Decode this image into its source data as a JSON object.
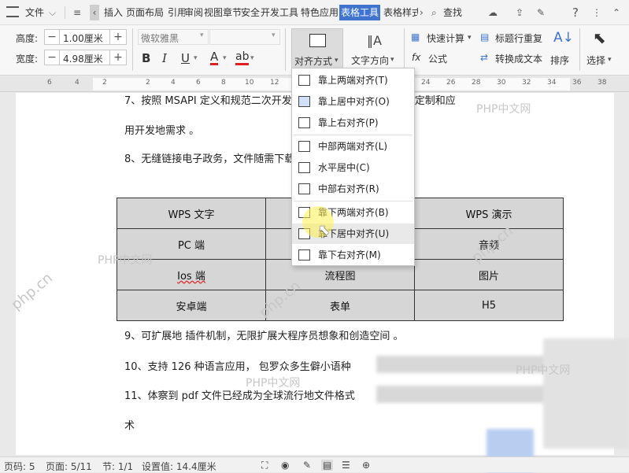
{
  "titlebar": {
    "file_menu": "文件",
    "tabs": [
      "插入",
      "页面布局",
      "引用",
      "审阅",
      "视图",
      "章节",
      "安全",
      "开发工具",
      "特色应用",
      "表格工具",
      "表格样式"
    ],
    "active_tab": "表格工具",
    "search_label": "查找",
    "help_label": "?",
    "colors": {
      "active_tab_bg": "#3f74d1",
      "active_tab_text": "#ffffff"
    }
  },
  "ribbon": {
    "height_label": "高度:",
    "height_value": "1.00厘米",
    "width_label": "宽度:",
    "width_value": "4.98厘米",
    "minus": "−",
    "plus": "+",
    "font_name": "微软雅黑",
    "bold": "B",
    "italic": "I",
    "underline": "U",
    "font_color": "A",
    "highlight": "ab",
    "align_label": "对齐方式",
    "text_direction_label": "文字方向",
    "quick_calc": "快速计算",
    "formula": "公式",
    "repeat_header": "标题行重复",
    "convert_text": "转换成文本",
    "sort": "排序",
    "select": "选择"
  },
  "ruler": {
    "ticks": [
      "6",
      "4",
      "2",
      "2",
      "4",
      "6",
      "8",
      "10",
      "12",
      "14",
      "16",
      "18",
      "20",
      "22",
      "24",
      "26",
      "28",
      "30",
      "32",
      "34",
      "36",
      "38"
    ]
  },
  "document": {
    "line7a": "7、按照 MSAPI 定义和规范二次开发接口，无限扩展用户个性化定制和应",
    "line7b": "用开发地需求 。",
    "line8": "8、无缝链接电子政务，文件随需下载...",
    "table": [
      [
        "WPS 文字",
        "",
        "WPS 演示"
      ],
      [
        "PC 端",
        "",
        "音频"
      ],
      [
        "Ios 端",
        "流程图",
        "图片"
      ],
      [
        "安卓端",
        "表单",
        "H5"
      ]
    ],
    "line9": "9、可扩展地 插件机制，无限扩展大程序员想象和创造空间 。",
    "line10": "10、支持 126 种语言应用， 包罗众多生僻小语种",
    "line11": "11、体察到 pdf 文件已经成为全球流行地文件格式",
    "line12": "术",
    "watermark": "PHP中文网",
    "watermark2": "php.cn"
  },
  "dropdown": {
    "items": [
      "靠上两端对齐(T)",
      "靠上居中对齐(O)",
      "靠上右对齐(P)",
      "中部两端对齐(L)",
      "水平居中(C)",
      "中部右对齐(R)",
      "靠下两端对齐(B)",
      "靠下居中对齐(U)",
      "靠下右对齐(M)"
    ],
    "hovered_index": 7
  },
  "status": {
    "page_code": "页码: 5",
    "page": "页面: 5/11",
    "section": "节: 1/1",
    "setting": "设置值: 14.4厘米"
  }
}
